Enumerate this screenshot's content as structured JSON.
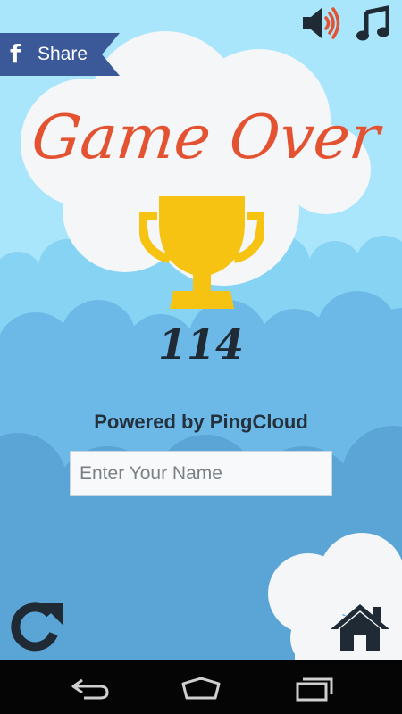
{
  "share_button": {
    "label": "Share",
    "icon": "facebook-icon"
  },
  "top_controls": {
    "sound_icon": "speaker-volume-icon",
    "music_icon": "music-note-icon"
  },
  "title": "Game Over",
  "score": "114",
  "powered_by": "Powered by PingCloud",
  "name_input": {
    "placeholder": "Enter Your Name",
    "value": ""
  },
  "bottom_controls": {
    "replay_icon": "replay-icon",
    "home_icon": "home-icon"
  },
  "system_nav": {
    "back_icon": "back-icon",
    "home_icon": "nav-home-icon",
    "recent_icon": "recent-apps-icon"
  },
  "colors": {
    "sky": "#a9e6fb",
    "title": "#e35231",
    "trophy": "#f7c312",
    "facebook": "#3b5998",
    "icons": "#1f2a35"
  }
}
